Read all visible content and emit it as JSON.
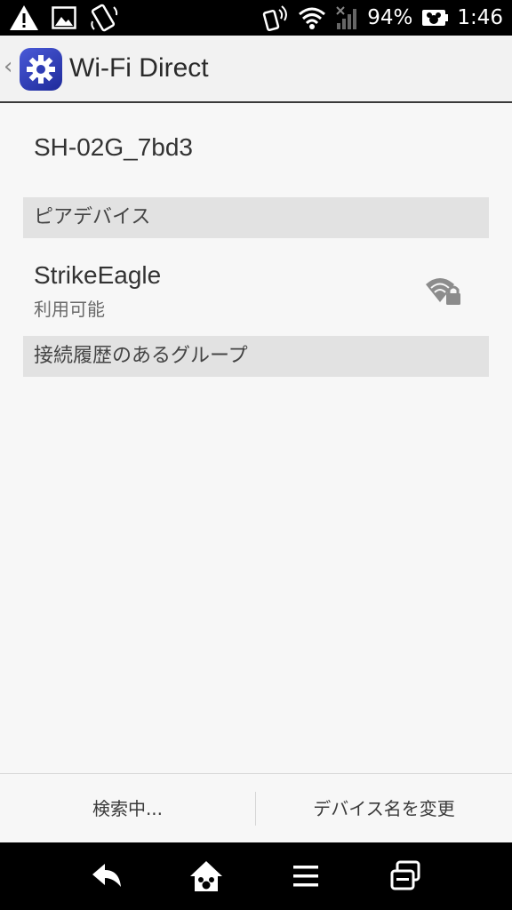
{
  "status_bar": {
    "battery": "94%",
    "time": "1:46",
    "icons": [
      "warning-icon",
      "image-icon",
      "rotate-icon",
      "nfc-icon",
      "wifi-icon",
      "signal-icon",
      "battery-icon"
    ]
  },
  "app_bar": {
    "title": "Wi-Fi Direct",
    "icon": "settings-gear-icon"
  },
  "my_device": {
    "name": "SH-02G_7bd3"
  },
  "sections": {
    "peer_devices": "ピアデバイス",
    "remembered_groups": "接続履歴のあるグループ"
  },
  "peers": [
    {
      "name": "StrikeEagle",
      "status": "利用可能",
      "icon": "wifi-lock-icon"
    }
  ],
  "actions": {
    "search": "検索中...",
    "rename": "デバイス名を変更"
  },
  "nav": [
    "back-icon",
    "home-icon",
    "menu-icon",
    "recents-icon"
  ],
  "colors": {
    "app_icon": "#2f3db5",
    "background": "#f7f7f7",
    "section_header": "#e2e2e2"
  }
}
